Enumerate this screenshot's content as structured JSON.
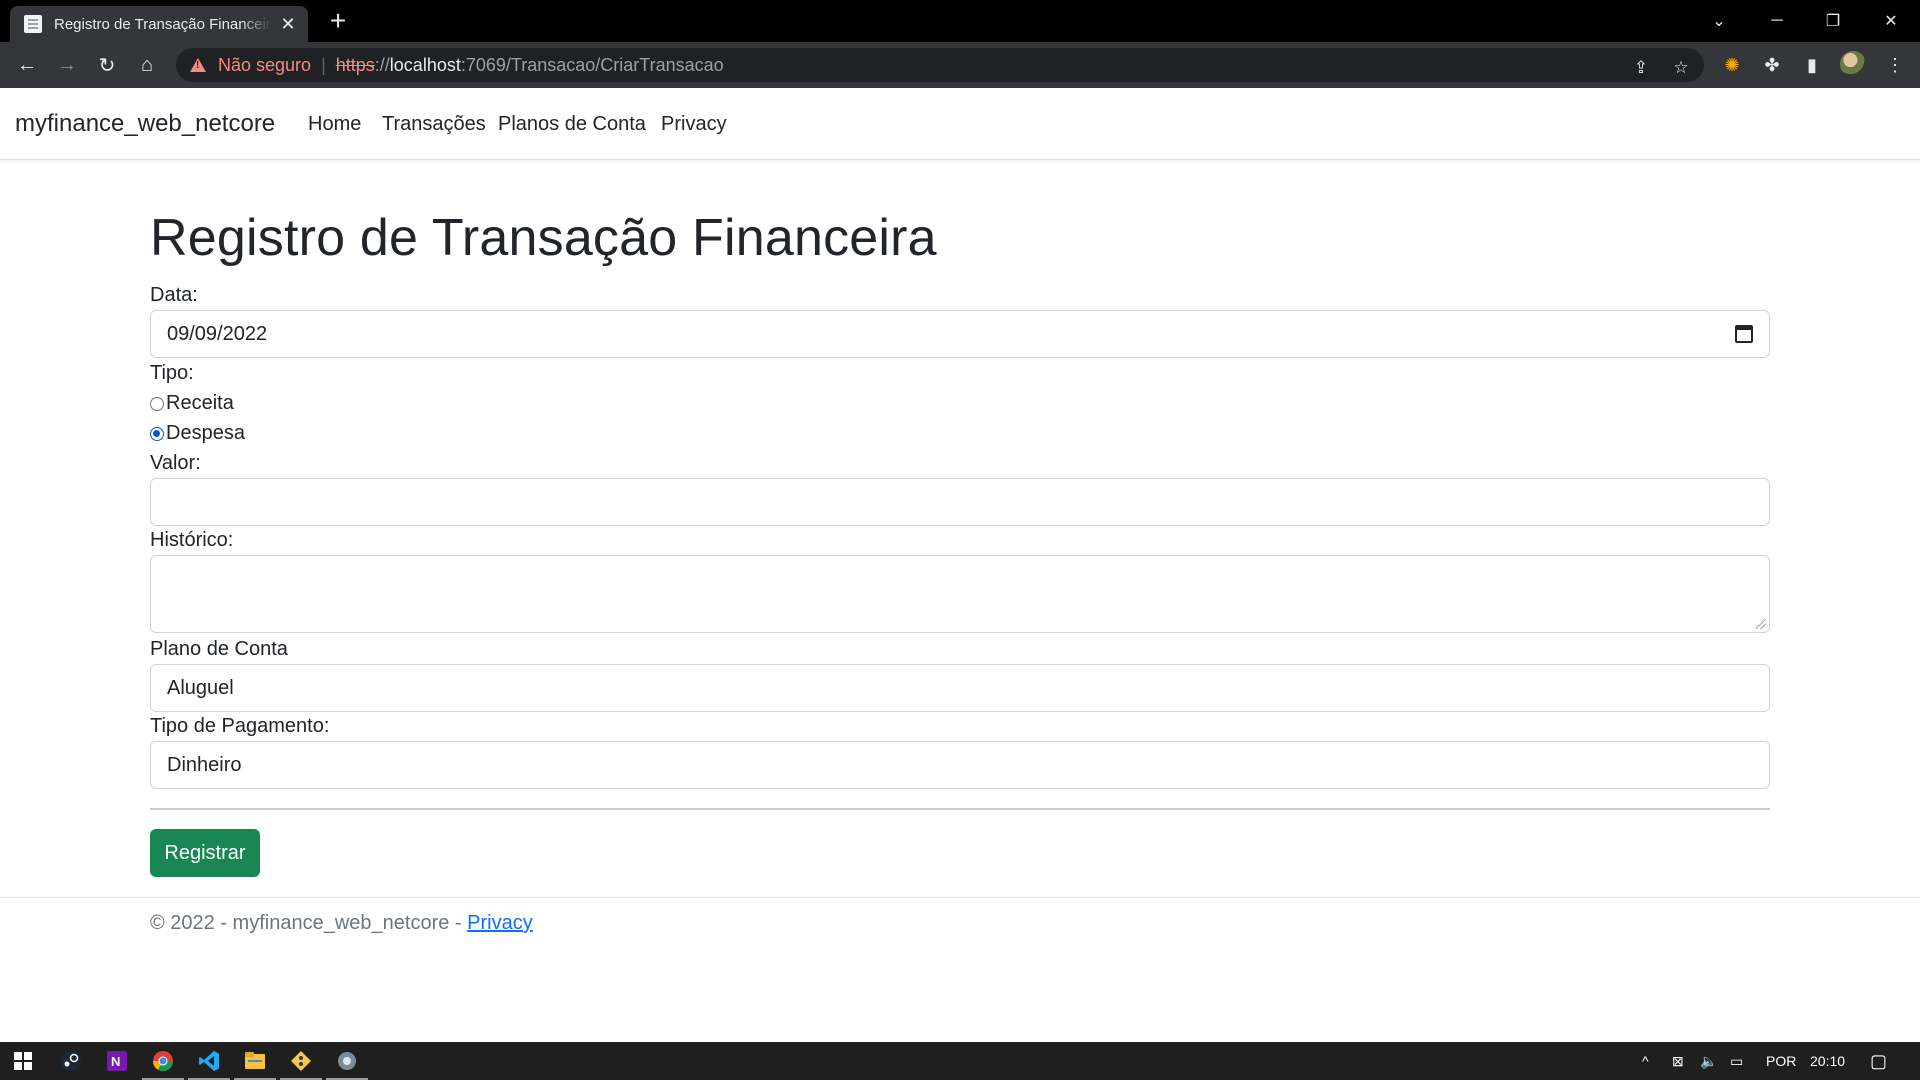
{
  "browser": {
    "tab_title": "Registro de Transação Financeira",
    "tab_close_icon": "close-icon",
    "new_tab_icon": "plus-icon",
    "security_label": "Não seguro",
    "url_protocol": "https",
    "url_separator": "://",
    "url_host": "localhost",
    "url_path": ":7069/Transacao/CriarTransacao"
  },
  "navbar": {
    "brand": "myfinance_web_netcore",
    "links": [
      "Home",
      "Transações",
      "Planos de Conta",
      "Privacy"
    ]
  },
  "form": {
    "heading": "Registro de Transação Financeira",
    "data_label": "Data:",
    "data_value": "09/09/2022",
    "tipo_label": "Tipo:",
    "tipo_options": [
      {
        "label": "Receita",
        "checked": false
      },
      {
        "label": "Despesa",
        "checked": true
      }
    ],
    "valor_label": "Valor:",
    "valor_value": "",
    "historico_label": "Histórico:",
    "historico_value": "",
    "plano_label": "Plano de Conta",
    "plano_value": "Aluguel",
    "pagamento_label": "Tipo de Pagamento:",
    "pagamento_value": "Dinheiro",
    "submit_label": "Registrar"
  },
  "footer": {
    "text": "© 2022 - myfinance_web_netcore - ",
    "link": "Privacy"
  },
  "taskbar": {
    "language": "POR",
    "time": "20:10"
  },
  "colors": {
    "primary_button": "#198754",
    "link": "#0d6efd",
    "not_secure": "#f28b82"
  }
}
